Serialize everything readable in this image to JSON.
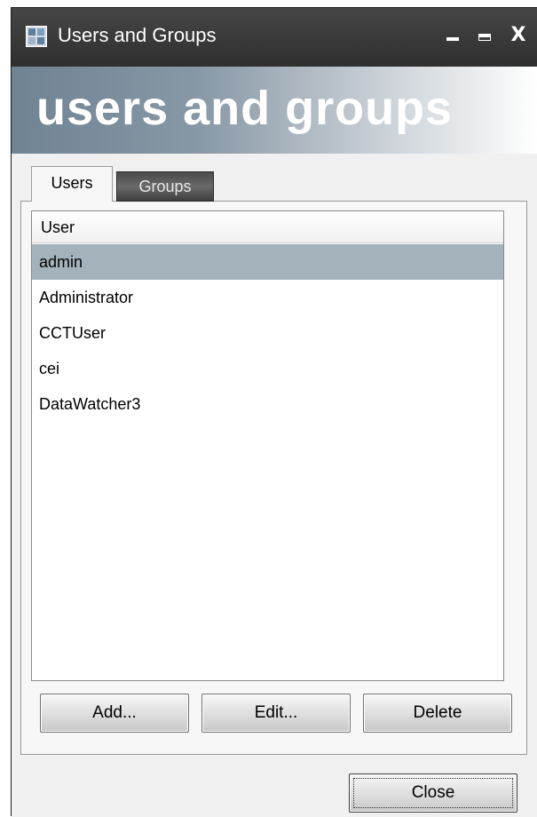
{
  "window": {
    "title": "Users and Groups",
    "icons": {
      "app": "app-grid-icon",
      "minimize": "minimize-icon",
      "maximize": "maximize-icon",
      "close": "close-icon"
    },
    "close_glyph": "X"
  },
  "banner": {
    "text": "users and groups"
  },
  "tabs": [
    {
      "label": "Users",
      "active": true
    },
    {
      "label": "Groups",
      "active": false
    }
  ],
  "users_list": {
    "column_header": "User",
    "rows": [
      "admin",
      "Administrator",
      "CCTUser",
      "cei",
      "DataWatcher3"
    ],
    "selected_index": 0
  },
  "actions": {
    "add_label": "Add...",
    "edit_label": "Edit...",
    "delete_label": "Delete"
  },
  "footer": {
    "close_label": "Close"
  },
  "colors": {
    "titlebar": "#3a3a3a",
    "selection": "#a4b3bb",
    "body": "#f0f0f0"
  }
}
